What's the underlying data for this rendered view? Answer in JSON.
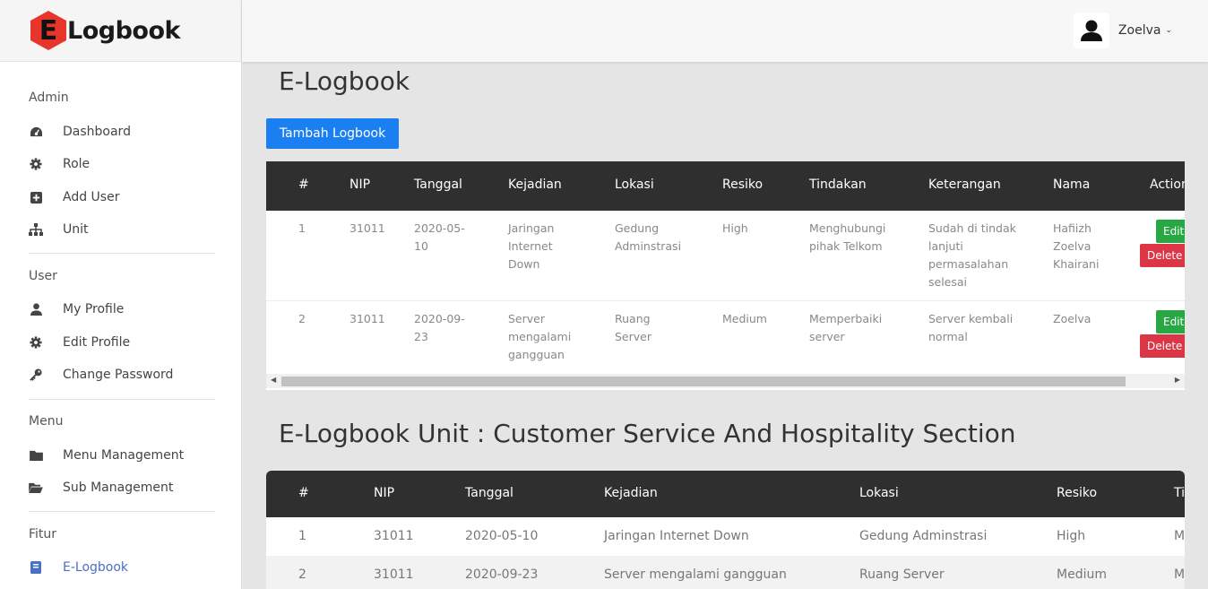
{
  "brand": {
    "letter": "E",
    "name": "Logbook"
  },
  "user": {
    "name": "Zoelva",
    "caret": "⌄"
  },
  "sidebar": {
    "sections": [
      {
        "heading": "Admin",
        "items": [
          {
            "label": "Dashboard",
            "icon": "dashboard-icon"
          },
          {
            "label": "Role",
            "icon": "gear-icon"
          },
          {
            "label": "Add User",
            "icon": "plus-square-icon"
          },
          {
            "label": "Unit",
            "icon": "sitemap-icon"
          }
        ]
      },
      {
        "heading": "User",
        "items": [
          {
            "label": "My Profile",
            "icon": "user-icon"
          },
          {
            "label": "Edit Profile",
            "icon": "gear-icon"
          },
          {
            "label": "Change Password",
            "icon": "key-icon"
          }
        ]
      },
      {
        "heading": "Menu",
        "items": [
          {
            "label": "Menu Management",
            "icon": "folder-icon"
          },
          {
            "label": "Sub Management",
            "icon": "folder-open-icon"
          }
        ]
      },
      {
        "heading": "Fitur",
        "items": [
          {
            "label": "E-Logbook",
            "icon": "book-icon",
            "active": true
          }
        ]
      }
    ]
  },
  "main": {
    "title": "E-Logbook",
    "add_button": "Tambah Logbook",
    "table1": {
      "headers": [
        "#",
        "NIP",
        "Tanggal",
        "Kejadian",
        "Lokasi",
        "Resiko",
        "Tindakan",
        "Keterangan",
        "Nama",
        "Action"
      ],
      "rows": [
        {
          "no": "1",
          "nip": "31011",
          "tanggal": "2020-05-10",
          "kejadian": "Jaringan Internet Down",
          "lokasi": "Gedung Adminstrasi",
          "resiko": "High",
          "tindakan": "Menghubungi pihak Telkom",
          "keterangan": "Sudah di tindak lanjuti permasalahan selesai",
          "nama": "Hafiizh Zoelva Khairani",
          "edit": "Edit",
          "delete": "Delete"
        },
        {
          "no": "2",
          "nip": "31011",
          "tanggal": "2020-09-23",
          "kejadian": "Server mengalami gangguan",
          "lokasi": "Ruang Server",
          "resiko": "Medium",
          "tindakan": "Memperbaiki server",
          "keterangan": "Server kembali normal",
          "nama": "Zoelva",
          "edit": "Edit",
          "delete": "Delete"
        }
      ]
    },
    "section2_title": "E-Logbook Unit : Customer Service And Hospitality Section",
    "table2": {
      "headers": [
        "#",
        "NIP",
        "Tanggal",
        "Kejadian",
        "Lokasi",
        "Resiko",
        "Ti"
      ],
      "rows": [
        {
          "no": "1",
          "nip": "31011",
          "tanggal": "2020-05-10",
          "kejadian": "Jaringan Internet Down",
          "lokasi": "Gedung Adminstrasi",
          "resiko": "High",
          "extra": "M"
        },
        {
          "no": "2",
          "nip": "31011",
          "tanggal": "2020-09-23",
          "kejadian": "Server mengalami gangguan",
          "lokasi": "Ruang Server",
          "resiko": "Medium",
          "extra": "M"
        }
      ]
    }
  }
}
